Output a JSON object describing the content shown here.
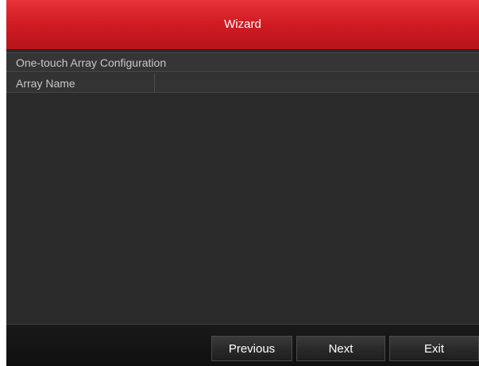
{
  "window": {
    "title": "Wizard"
  },
  "section": {
    "header": "One-touch Array Configuration"
  },
  "form": {
    "array_name_label": "Array Name",
    "array_name_value": ""
  },
  "footer": {
    "previous_label": "Previous",
    "next_label": "Next",
    "exit_label": "Exit"
  },
  "colors": {
    "titlebar_red": "#d31c24",
    "panel_bg": "#2a2a2a",
    "footer_bg": "#111111"
  }
}
